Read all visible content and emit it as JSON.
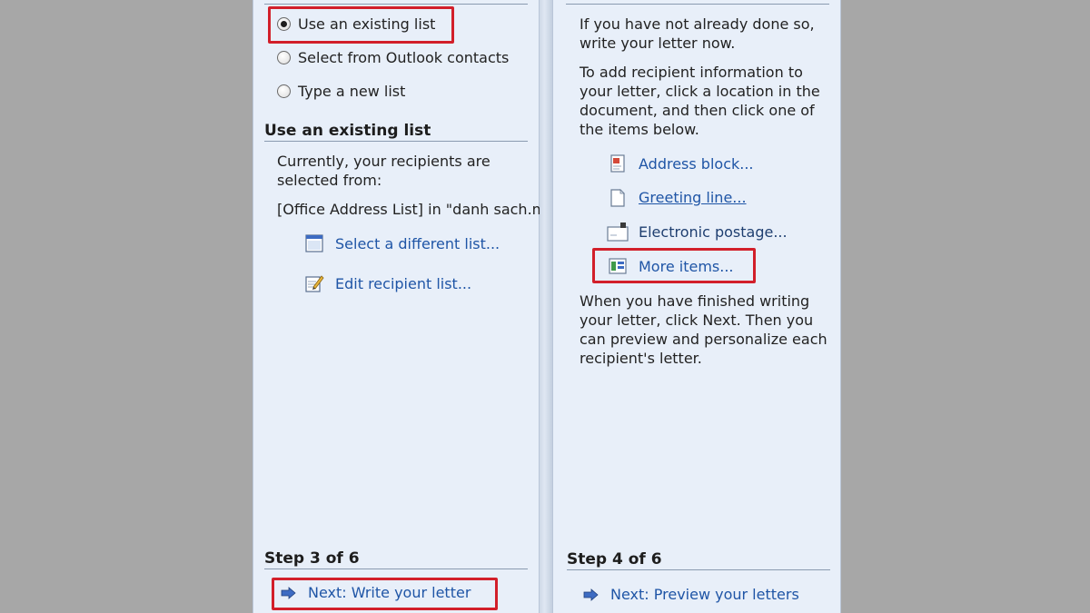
{
  "left": {
    "radio_options": [
      {
        "label": "Use an existing list",
        "checked": true
      },
      {
        "label": "Select from Outlook contacts",
        "checked": false
      },
      {
        "label": "Type a new list",
        "checked": false
      }
    ],
    "section_heading": "Use an existing list",
    "description": "Currently, your recipients are selected from:",
    "source_text": "[Office Address List] in \"danh sach.m",
    "links": {
      "select_different": "Select a different list...",
      "edit_recipients": "Edit recipient list..."
    },
    "step_label": "Step 3 of 6",
    "next_label": "Next: Write your letter"
  },
  "right": {
    "intro": "If you have not already done so, write your letter now.",
    "instructions": "To add recipient information to your letter, click a location in the document, and then click one of the items below.",
    "items": {
      "address_block": "Address block...",
      "greeting_line": "Greeting line...",
      "electronic_postage": "Electronic postage...",
      "more_items": "More items..."
    },
    "finish_text": "When you have finished writing your letter, click Next. Then you can preview and personalize each recipient's letter.",
    "step_label": "Step 4 of 6",
    "next_label": "Next: Preview your letters"
  },
  "colors": {
    "panel_bg": "#e8eff9",
    "link": "#1f55a6",
    "highlight": "#d21f2a",
    "page_bg": "#a7a7a7"
  }
}
